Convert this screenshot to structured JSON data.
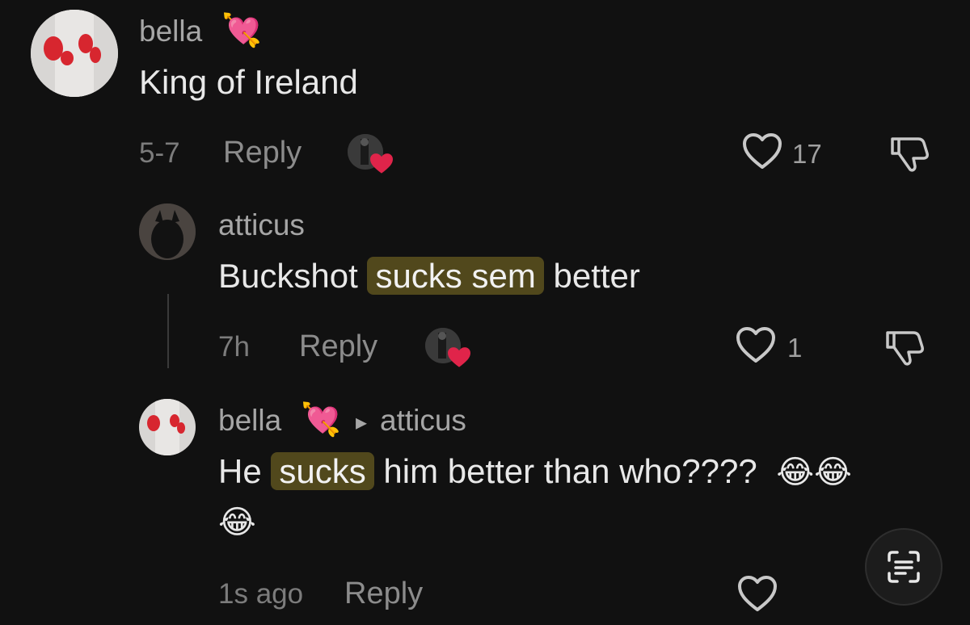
{
  "comments": [
    {
      "username": "bella",
      "username_emoji": "💘",
      "text": "King of Ireland",
      "time": "5-7",
      "reply_label": "Reply",
      "likes": "17"
    },
    {
      "username": "atticus",
      "text_before": "Buckshot ",
      "text_highlight": "sucks sem",
      "text_after": " better",
      "time": "7h",
      "reply_label": "Reply",
      "likes": "1"
    },
    {
      "username": "bella",
      "username_emoji": "💘",
      "reply_to_arrow": "▸",
      "reply_to": "atticus",
      "text_before": "He ",
      "text_highlight": "sucks",
      "text_after": " him better than who????",
      "emojis_line1": "😂😂",
      "emojis_line2": "😂",
      "time": "1s ago",
      "reply_label": "Reply"
    }
  ],
  "colors": {
    "background": "#111111",
    "highlight": "#51481c",
    "heart_red": "#e0244a"
  },
  "icons": {
    "like": "heart-outline-icon",
    "dislike": "thumbs-down-icon",
    "creator_liked": "red-heart-icon",
    "scan": "text-scan-icon"
  }
}
